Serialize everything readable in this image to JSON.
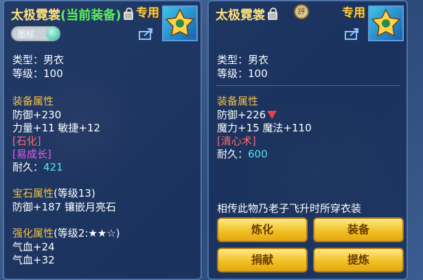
{
  "left_panel": {
    "title": "太极霓裳",
    "title_suffix": "(当前装备)",
    "special_tag": "专用",
    "toggle_label": "图标",
    "type": "类型：男衣",
    "level": "等级：100",
    "equip_attr_header": "装备属性",
    "defense": "防御+230",
    "stats": "力量+11 敏捷+12",
    "effect_1": "[石化]",
    "effect_2": "[易成长]",
    "durability_label": "耐久：",
    "durability_value": "421",
    "gem_header": "宝石属性",
    "gem_level": "(等级13)",
    "gem_detail": "防御+187 镶嵌月亮石",
    "enhance_header": "强化属性",
    "enhance_level": "(等级2:★★☆)",
    "enhance_1": "气血+24",
    "enhance_2": "气血+32"
  },
  "right_panel": {
    "title": "太极霓裳",
    "special_tag": "专用",
    "seal_char": "評",
    "type": "类型：男衣",
    "level": "等级：100",
    "equip_attr_header": "装备属性",
    "defense": "防御+226",
    "stats": "魔力+15 魔法+110",
    "effect_1": "[清心术]",
    "durability_label": "耐久：",
    "durability_value": "600",
    "description": "相传此物乃老子飞升时所穿衣装",
    "buttons": {
      "refine": "炼化",
      "equip": "装备",
      "donate": "捐献",
      "extract": "提炼"
    }
  },
  "colors": {
    "gold_title": "#ffe27a",
    "green": "#5cf05c",
    "section": "#f2c04a",
    "red_effect": "#ff6a6a",
    "pink_effect": "#e95ae9",
    "cyan_value": "#4fe4f0",
    "button": "#f2c026"
  }
}
